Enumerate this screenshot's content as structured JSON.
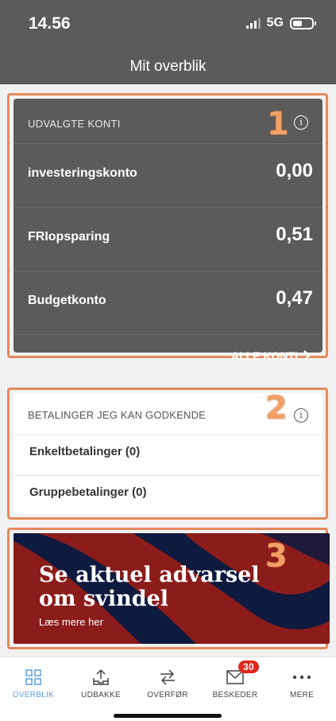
{
  "status_bar": {
    "time": "14.56",
    "network": "5G"
  },
  "header": {
    "title": "Mit overblik"
  },
  "annotations": [
    "1",
    "2",
    "3"
  ],
  "selected_accounts": {
    "title": "UDVALGTE KONTI",
    "accounts": [
      {
        "name": "investeringskonto",
        "amount": "0,00"
      },
      {
        "name": "FRIopsparing",
        "amount": "0,51"
      },
      {
        "name": "Budgetkonto",
        "amount": "0,47"
      }
    ],
    "all_accounts_label": "ALLE KONTI"
  },
  "payments": {
    "title": "BETALINGER JEG KAN GODKENDE",
    "items": [
      {
        "label": "Enkeltbetalinger (0)"
      },
      {
        "label": "Gruppebetalinger (0)"
      }
    ]
  },
  "banner": {
    "title_line1": "Se aktuel advarsel",
    "title_line2": "om svindel",
    "subtitle": "Læs mere her"
  },
  "tabbar": {
    "tabs": [
      {
        "label": "OVERBLIK",
        "icon": "grid-icon",
        "active": true
      },
      {
        "label": "UDBAKKE",
        "icon": "outbox-icon"
      },
      {
        "label": "OVERFØR",
        "icon": "transfer-icon"
      },
      {
        "label": "BESKEDER",
        "icon": "mail-icon",
        "badge": "30"
      },
      {
        "label": "MERE",
        "icon": "more-icon"
      }
    ]
  },
  "colors": {
    "header_bg": "#5b5b5b",
    "annotation": "#e58a5c",
    "banner_bg": "#8b1c1a",
    "banner_stripe": "#0f1a3f",
    "active_tab": "#5a9fe0",
    "badge": "#e1261d"
  }
}
